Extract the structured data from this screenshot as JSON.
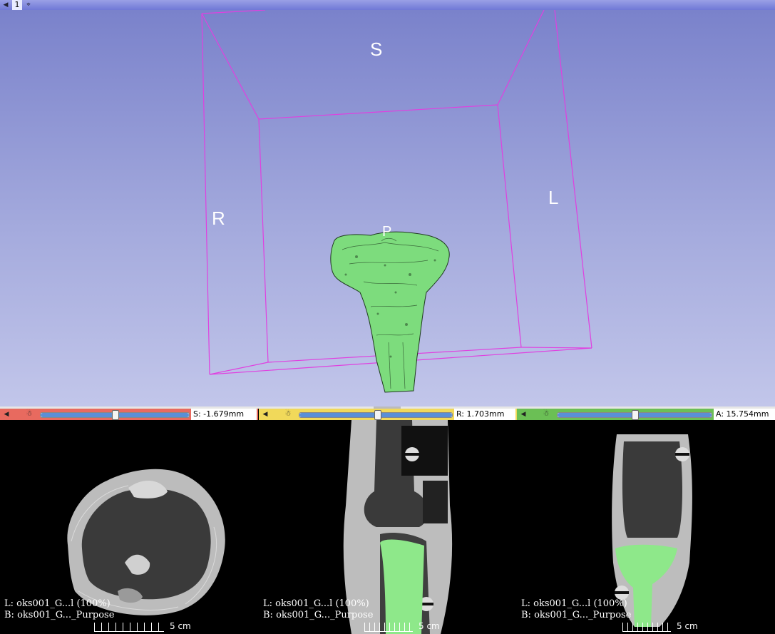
{
  "view3d": {
    "view_number": "1",
    "orientation": {
      "superior": "S",
      "right": "R",
      "left": "L",
      "posterior": "P"
    },
    "colors": {
      "box": "#e040e0",
      "model": "#7ddc7d",
      "bg_top": "#7a82cb",
      "bg_bottom": "#c2c6ea"
    }
  },
  "slices": [
    {
      "name": "red",
      "offset": "S: -1.679mm",
      "slider_pos": 0.48,
      "layer_l": "L: oks001_G...l (100%)",
      "layer_b": "B: oks001_G..._Purpose",
      "scale": "5 cm",
      "color": "#e86a5f"
    },
    {
      "name": "yellow",
      "offset": "R: 1.703mm",
      "slider_pos": 0.51,
      "layer_l": "L: oks001_G...l (100%)",
      "layer_b": "B: oks001_G..._Purpose",
      "scale": "5 cm",
      "color": "#f1d95a"
    },
    {
      "name": "green",
      "offset": "A: 15.754mm",
      "slider_pos": 0.5,
      "layer_l": "L: oks001_G...l (100%)",
      "layer_b": "B: oks001_G..._Purpose",
      "scale": "5 cm",
      "color": "#6bbf55"
    }
  ],
  "icons": {
    "pin": "pin-icon",
    "link": "link-icon",
    "center": "center-view-icon"
  }
}
